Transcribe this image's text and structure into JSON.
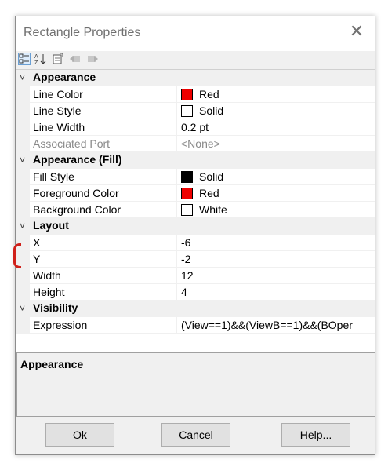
{
  "window": {
    "title": "Rectangle Properties",
    "close_glyph": "✕"
  },
  "toolbar": {
    "icons": [
      "categorized-icon",
      "alphabetical-icon",
      "property-pages-icon",
      "back-icon",
      "forward-icon"
    ]
  },
  "categories": {
    "appearance": {
      "label": "Appearance",
      "chevron": "˅"
    },
    "appearance_fill": {
      "label": "Appearance (Fill)",
      "chevron": "˅"
    },
    "layout": {
      "label": "Layout",
      "chevron": "˅"
    },
    "visibility": {
      "label": "Visibility",
      "chevron": "˅"
    }
  },
  "props": {
    "line_color": {
      "name": "Line Color",
      "value": "Red",
      "color": "#ee0000"
    },
    "line_style": {
      "name": "Line Style",
      "value": "Solid"
    },
    "line_width": {
      "name": "Line Width",
      "value": "0.2 pt"
    },
    "associated_port": {
      "name": "Associated Port",
      "value": "<None>"
    },
    "fill_style": {
      "name": "Fill Style",
      "value": "Solid",
      "color": "#000000"
    },
    "foreground_color": {
      "name": "Foreground Color",
      "value": "Red",
      "color": "#ee0000"
    },
    "background_color": {
      "name": "Background Color",
      "value": "White",
      "color": "#ffffff"
    },
    "x": {
      "name": "X",
      "value": "-6"
    },
    "y": {
      "name": "Y",
      "value": "-2"
    },
    "width": {
      "name": "Width",
      "value": "12"
    },
    "height": {
      "name": "Height",
      "value": "4"
    },
    "expression": {
      "name": "Expression",
      "value": "(View==1)&&(ViewB==1)&&(BOper"
    }
  },
  "description": {
    "title": "Appearance"
  },
  "buttons": {
    "ok": "Ok",
    "cancel": "Cancel",
    "help": "Help..."
  },
  "annotation": {
    "color": "#d0201a"
  }
}
